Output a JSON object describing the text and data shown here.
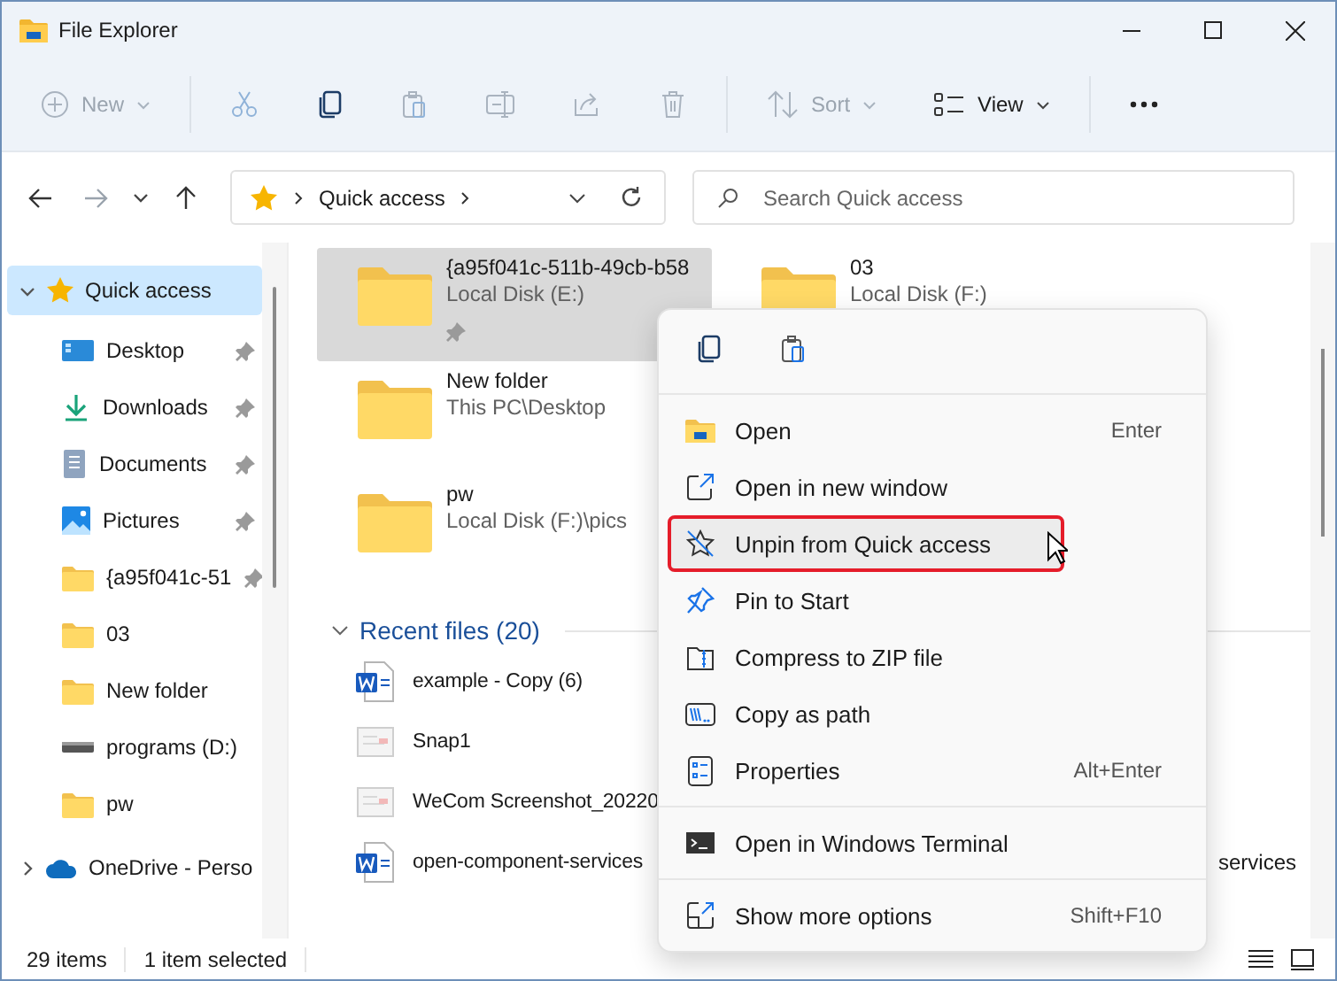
{
  "window": {
    "title": "File Explorer"
  },
  "toolbar": [
    {
      "kind": "button",
      "label": "New",
      "disabled": true,
      "dropdown": true
    },
    {
      "kind": "separator"
    },
    {
      "kind": "button",
      "disabled": true
    },
    {
      "kind": "button",
      "disabled": false
    },
    {
      "kind": "button",
      "disabled": true
    },
    {
      "kind": "button",
      "disabled": true
    },
    {
      "kind": "button",
      "disabled": true
    },
    {
      "kind": "button",
      "disabled": true
    },
    {
      "kind": "separator"
    },
    {
      "kind": "button",
      "label": "Sort",
      "disabled": true,
      "dropdown": true
    },
    {
      "kind": "button",
      "label": "View",
      "disabled": false,
      "dropdown": true
    },
    {
      "kind": "separator"
    },
    {
      "kind": "button",
      "disabled": false
    }
  ],
  "nav": [
    {
      "disabled": false
    },
    {
      "disabled": true
    },
    {
      "disabled": false
    },
    {
      "disabled": false
    }
  ],
  "address": {
    "breadcrumbs": [
      "Quick access"
    ]
  },
  "search": {
    "placeholder": "Search Quick access"
  },
  "sidebar": {
    "items": [
      {
        "label": "Quick access",
        "selected": true,
        "expanded": true,
        "children": [
          {
            "label": "Desktop",
            "pinned": true,
            "selected": false
          },
          {
            "label": "Downloads",
            "pinned": true,
            "selected": false
          },
          {
            "label": "Documents",
            "pinned": true,
            "selected": false
          },
          {
            "label": "Pictures",
            "pinned": true,
            "selected": false
          },
          {
            "label": "{a95f041c-51",
            "pinned": true,
            "selected": false
          },
          {
            "label": "03",
            "pinned": false,
            "selected": false
          },
          {
            "label": "New folder",
            "pinned": false,
            "selected": false
          },
          {
            "label": "programs (D:)",
            "pinned": false,
            "selected": false
          },
          {
            "label": "pw",
            "pinned": false,
            "selected": false
          }
        ]
      },
      {
        "label": "OneDrive - Perso",
        "selected": false,
        "expanded": false
      }
    ]
  },
  "folders": [
    {
      "name": "{a95f041c-511b-49cb-b58",
      "location": "Local Disk (E:)",
      "pinned": true,
      "selected": true
    },
    {
      "name": "New folder",
      "location": "This PC\\Desktop",
      "pinned": false,
      "selected": false
    },
    {
      "name": "pw",
      "location": "Local Disk (F:)\\pics",
      "pinned": false,
      "selected": false
    },
    {
      "name": "03",
      "location": "Local Disk (F:)",
      "pinned": false,
      "selected": false
    }
  ],
  "recent": {
    "title": "Recent files (20)",
    "expanded": true,
    "rows": [
      {
        "name": "example - Copy (6)"
      },
      {
        "name": "Snap1"
      },
      {
        "name": "WeCom Screenshot_20220"
      },
      {
        "name": "open-component-services",
        "column_2": "services"
      }
    ]
  },
  "context_menu": {
    "items": [
      {
        "kind": "item",
        "label": "Open",
        "shortcut": "Enter",
        "highlighted": false
      },
      {
        "kind": "item",
        "label": "Open in new window",
        "highlighted": false
      },
      {
        "kind": "item",
        "label": "Unpin from Quick access",
        "highlighted": true
      },
      {
        "kind": "item",
        "label": "Pin to Start",
        "highlighted": false
      },
      {
        "kind": "item",
        "label": "Compress to ZIP file",
        "highlighted": false
      },
      {
        "kind": "item",
        "label": "Copy as path",
        "highlighted": false
      },
      {
        "kind": "item",
        "label": "Properties",
        "shortcut": "Alt+Enter",
        "highlighted": false
      },
      {
        "kind": "separator"
      },
      {
        "kind": "item",
        "label": "Open in Windows Terminal",
        "highlighted": false
      },
      {
        "kind": "separator"
      },
      {
        "kind": "item",
        "label": "Show more options",
        "shortcut": "Shift+F10",
        "highlighted": false
      }
    ]
  },
  "status_bar": {
    "items": "29 items",
    "selection": "1 item selected"
  }
}
